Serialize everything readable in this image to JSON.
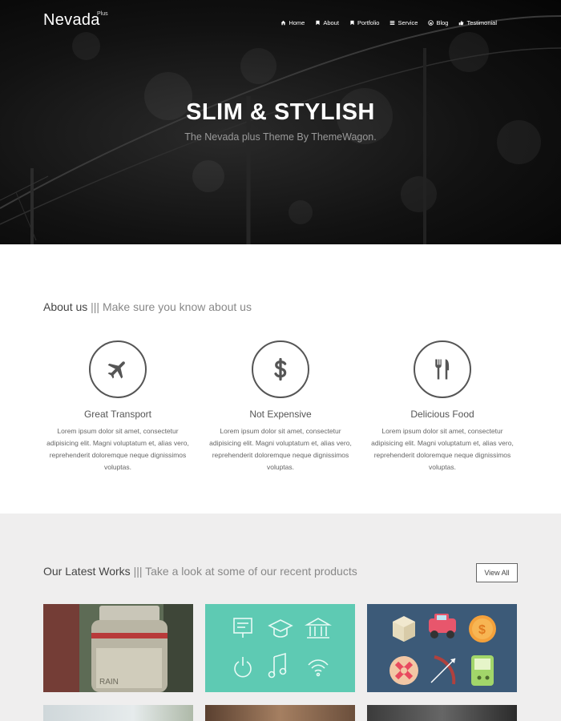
{
  "brand": {
    "name": "Nevada",
    "sup": "Plus"
  },
  "nav": [
    {
      "label": "Home",
      "icon": "home-icon"
    },
    {
      "label": "About",
      "icon": "bookmark-icon"
    },
    {
      "label": "Portfolio",
      "icon": "bookmark-icon"
    },
    {
      "label": "Service",
      "icon": "list-icon"
    },
    {
      "label": "Blog",
      "icon": "wordpress-icon"
    },
    {
      "label": "Testimonial",
      "icon": "thumbs-up-icon"
    }
  ],
  "hero": {
    "title": "SLIM & STYLISH",
    "subtitle": "The Nevada plus Theme By ThemeWagon."
  },
  "about": {
    "heading": "About us",
    "divider": "|||",
    "tagline": "Make sure you know about us",
    "features": [
      {
        "title": "Great Transport",
        "icon": "plane-icon",
        "text": "Lorem ipsum dolor sit amet, consectetur adipisicing elit. Magni voluptatum et, alias vero, reprehenderit doloremque neque dignissimos voluptas."
      },
      {
        "title": "Not Expensive",
        "icon": "dollar-icon",
        "text": "Lorem ipsum dolor sit amet, consectetur adipisicing elit. Magni voluptatum et, alias vero, reprehenderit doloremque neque dignissimos voluptas."
      },
      {
        "title": "Delicious Food",
        "icon": "cutlery-icon",
        "text": "Lorem ipsum dolor sit amet, consectetur adipisicing elit. Magni voluptatum et, alias vero, reprehenderit doloremque neque dignissimos voluptas."
      }
    ]
  },
  "works": {
    "heading": "Our Latest Works",
    "divider": "|||",
    "tagline": "Take a look at some of our recent products",
    "view_all": "View All",
    "thumb_label": "RAIN"
  },
  "colors": {
    "teal": "#5ecab3",
    "slate": "#3c5a78",
    "dark": "#0d0d0d",
    "section_grey": "#efeeee"
  }
}
